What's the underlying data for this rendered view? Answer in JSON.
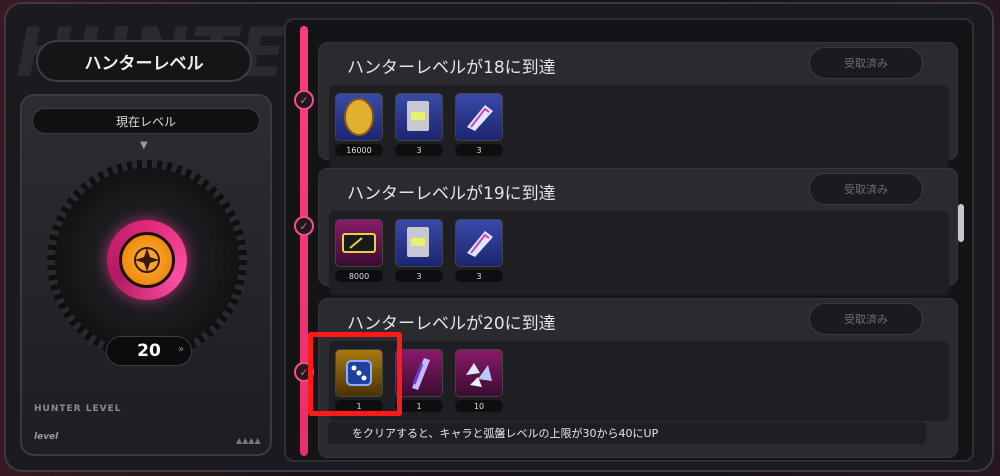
{
  "left": {
    "title": "ハンターレベル",
    "current_label": "現在レベル",
    "level": "20",
    "bg_text": "HUNTER",
    "hunter_level_text": "HUNTER LEVEL",
    "logo_text": "level"
  },
  "missions": [
    {
      "title": "ハンターレベルが18に到達",
      "status": "受取済み",
      "rewards": [
        {
          "icon": "gold-egg-icon",
          "count": "16000"
        },
        {
          "icon": "ticket-card-icon",
          "count": "3"
        },
        {
          "icon": "gem-crystal-icon",
          "count": "3"
        }
      ]
    },
    {
      "title": "ハンターレベルが19に到達",
      "status": "受取済み",
      "rewards": [
        {
          "icon": "pass-card-icon",
          "count": "8000"
        },
        {
          "icon": "ticket-card-icon",
          "count": "3"
        },
        {
          "icon": "gem-crystal-icon",
          "count": "3"
        }
      ]
    },
    {
      "title": "ハンターレベルが20に到達",
      "status": "受取済み",
      "rewards": [
        {
          "icon": "dice-icon",
          "count": "1"
        },
        {
          "icon": "potion-vial-icon",
          "count": "1"
        },
        {
          "icon": "crystal-shards-icon",
          "count": "10"
        }
      ],
      "description": "をクリアすると、キャラと弧盤レベルの上限が30から40にUP"
    }
  ],
  "colors": {
    "accent": "#ff3b7d",
    "highlight": "#ff1a1a"
  }
}
